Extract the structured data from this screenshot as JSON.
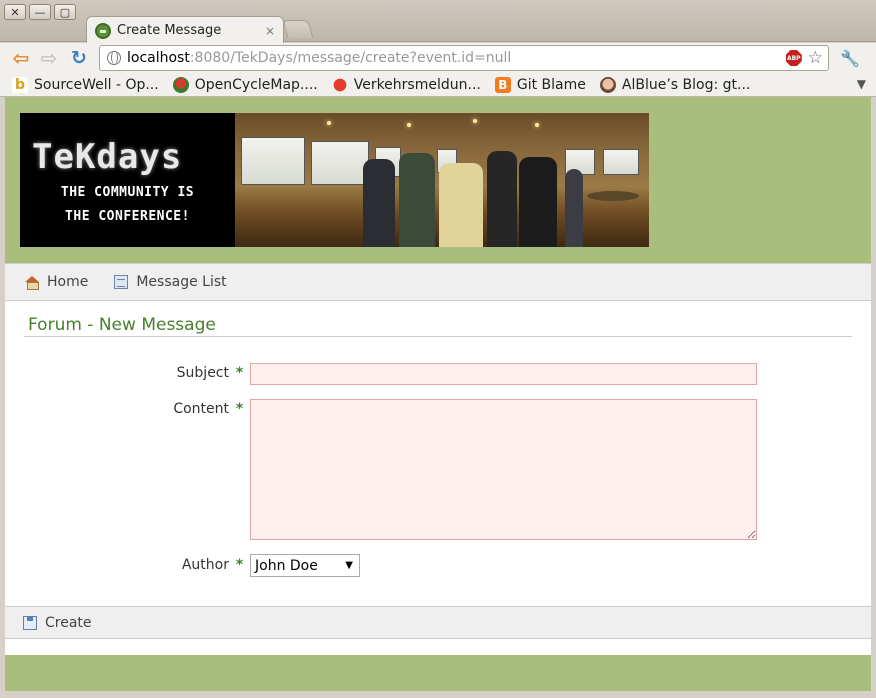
{
  "window": {
    "buttons": [
      "✕",
      "—",
      "▢"
    ]
  },
  "tab": {
    "title": "Create Message",
    "close": "×"
  },
  "omnibox": {
    "host": "localhost",
    "rest": ":8080/TekDays/message/create?event.id=null"
  },
  "bookmarks": [
    {
      "label": "SourceWell - Op...",
      "icon": "b-icon"
    },
    {
      "label": "OpenCycleMap....",
      "icon": "cycle-icon"
    },
    {
      "label": "Verkehrsmeldun...",
      "icon": "traffic-icon"
    },
    {
      "label": "Git Blame",
      "icon": "blogger-icon"
    },
    {
      "label": "AlBlue’s Blog: gt...",
      "icon": "avatar-icon"
    }
  ],
  "banner": {
    "logo_text": "TeKdays",
    "tagline_1": "THE COMMUNITY IS",
    "tagline_2": "THE CONFERENCE!"
  },
  "nav": {
    "home": "Home",
    "message_list": "Message List"
  },
  "page": {
    "title": "Forum - New Message"
  },
  "form": {
    "subject_label": "Subject",
    "content_label": "Content",
    "author_label": "Author",
    "required_mark": "*",
    "subject_value": "",
    "content_value": "",
    "author_selected": "John Doe"
  },
  "buttons": {
    "create": "Create"
  },
  "colors": {
    "header_green": "#a9bd7c",
    "title_green": "#48802c",
    "invalid_bg": "#fff0f0",
    "invalid_border": "#e8a3a3"
  }
}
